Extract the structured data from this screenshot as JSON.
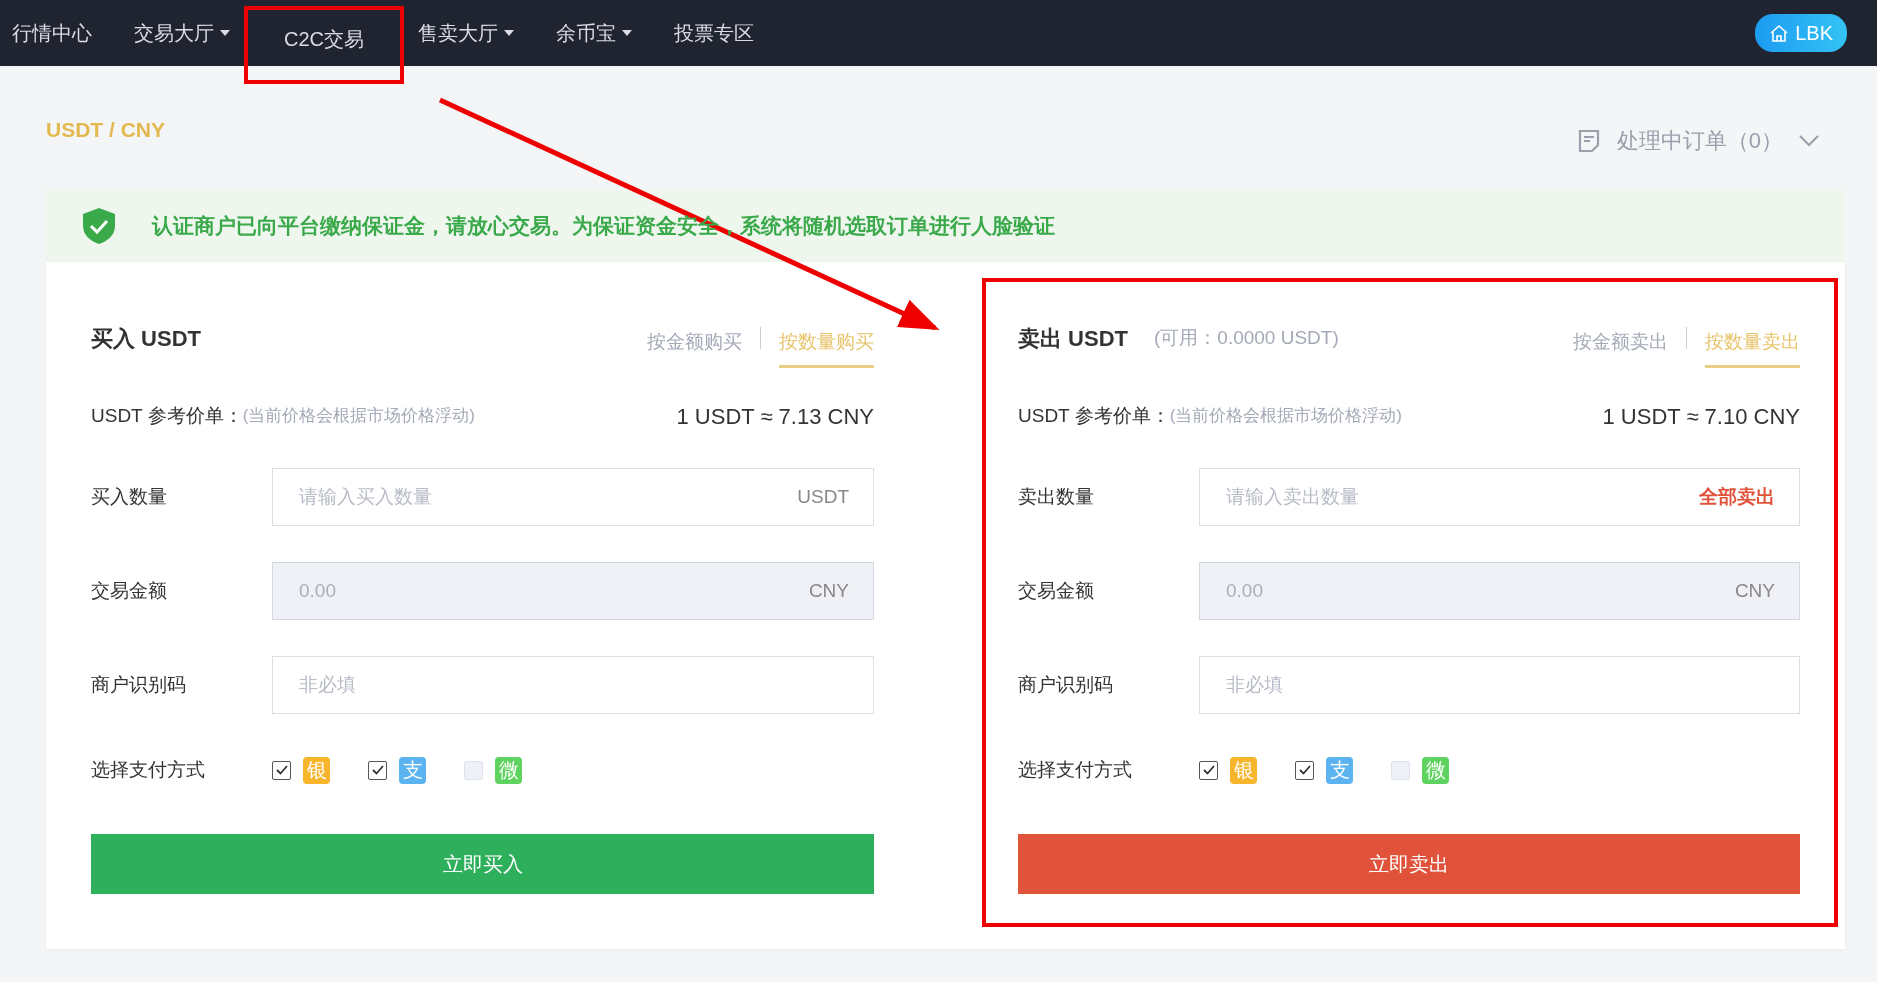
{
  "nav": {
    "items": [
      {
        "label": "行情中心",
        "dropdown": false,
        "highlighted": false
      },
      {
        "label": "交易大厅",
        "dropdown": true,
        "highlighted": false
      },
      {
        "label": "C2C交易",
        "dropdown": false,
        "highlighted": true
      },
      {
        "label": "售卖大厅",
        "dropdown": true,
        "highlighted": false
      },
      {
        "label": "余币宝",
        "dropdown": true,
        "highlighted": false
      },
      {
        "label": "投票专区",
        "dropdown": false,
        "highlighted": false
      }
    ],
    "account_button": "LBK"
  },
  "pair_title": "USDT / CNY",
  "pending_orders": "处理中订单（0）",
  "notice": "认证商户已向平台缴纳保证金，请放心交易。为保证资金安全，系统将随机选取订单进行人脸验证",
  "arrow": true,
  "panels": [
    {
      "kind": "buy",
      "highlighted": false,
      "title": "买入 USDT",
      "tabs": [
        {
          "label": "按金额购买",
          "selected": false
        },
        {
          "label": "按数量购买",
          "selected": true
        }
      ],
      "price_label": "USDT 参考价单：",
      "price_note": "(当前价格会根据市场价格浮动)",
      "price": "1 USDT ≈ 7.13 CNY",
      "fields": [
        {
          "label": "买入数量",
          "placeholder": "请输入买入数量",
          "unit": "USDT",
          "disabled": false
        },
        {
          "label": "交易金额",
          "placeholder": "0.00",
          "unit": "CNY",
          "disabled": true
        },
        {
          "label": "商户识别码",
          "placeholder": "非必填",
          "disabled": false
        }
      ],
      "payment_label": "选择支付方式",
      "payments": [
        {
          "icon": "银",
          "color": "#f7b52c",
          "checked": true
        },
        {
          "icon": "支",
          "color": "#5bb3f0",
          "checked": true
        },
        {
          "icon": "微",
          "color": "#5fd35f",
          "checked": false
        }
      ],
      "submit": "立即买入"
    },
    {
      "kind": "sell",
      "highlighted": true,
      "title": "卖出 USDT",
      "available": "(可用：0.0000 USDT)",
      "tabs": [
        {
          "label": "按金额卖出",
          "selected": false
        },
        {
          "label": "按数量卖出",
          "selected": true
        }
      ],
      "price_label": "USDT 参考价单：",
      "price_note": "(当前价格会根据市场价格浮动)",
      "price": "1 USDT ≈ 7.10 CNY",
      "fields": [
        {
          "label": "卖出数量",
          "placeholder": "请输入卖出数量",
          "action": "全部卖出",
          "disabled": false
        },
        {
          "label": "交易金额",
          "placeholder": "0.00",
          "unit": "CNY",
          "disabled": true
        },
        {
          "label": "商户识别码",
          "placeholder": "非必填",
          "disabled": false
        }
      ],
      "payment_label": "选择支付方式",
      "payments": [
        {
          "icon": "银",
          "color": "#f7b52c",
          "checked": true
        },
        {
          "icon": "支",
          "color": "#5bb3f0",
          "checked": true
        },
        {
          "icon": "微",
          "color": "#5fd35f",
          "checked": false
        }
      ],
      "submit": "立即卖出"
    }
  ]
}
